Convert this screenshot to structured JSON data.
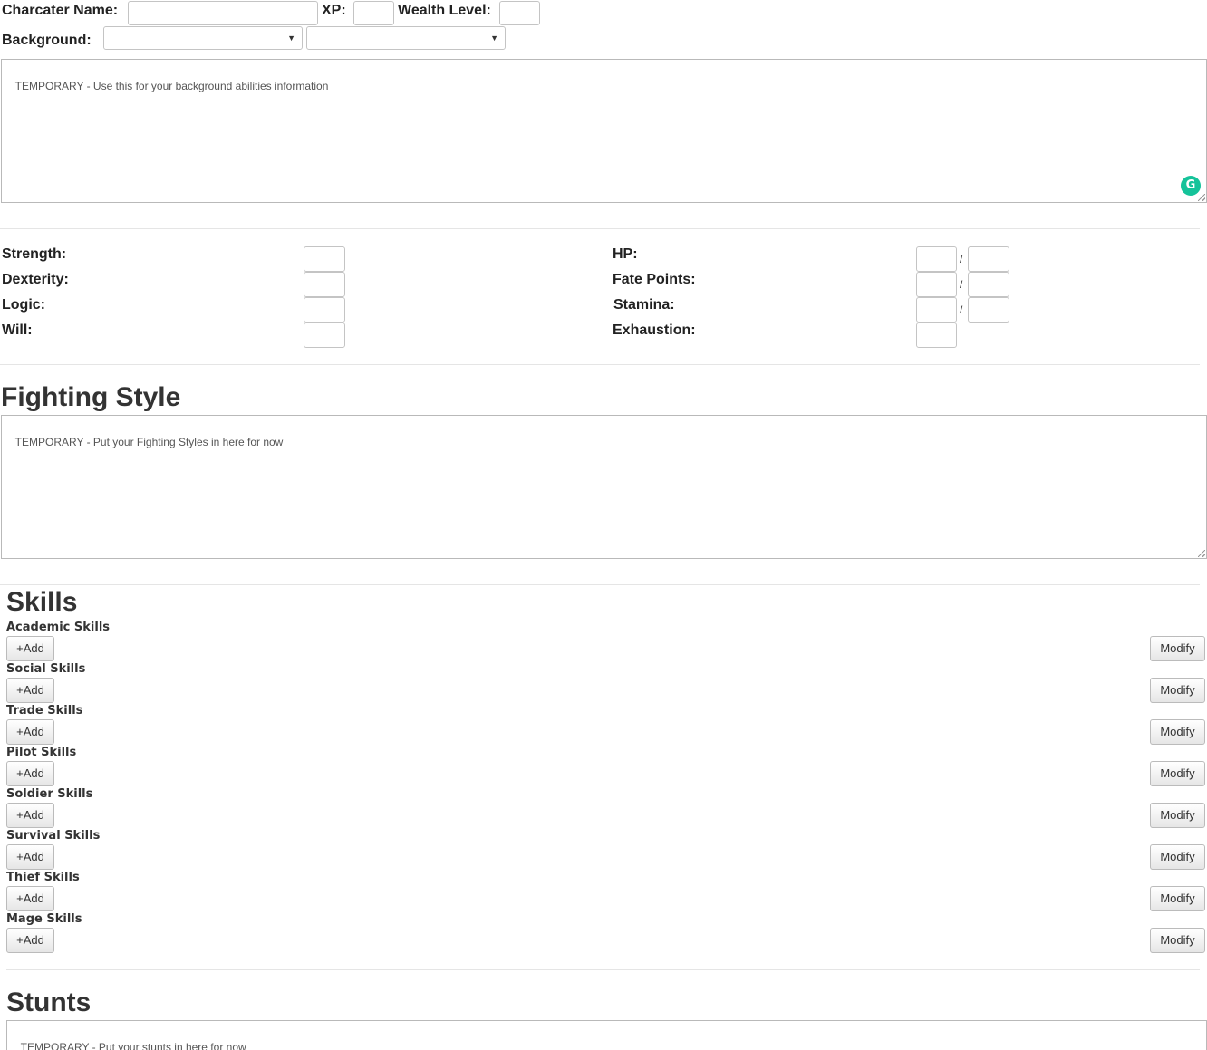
{
  "header": {
    "character_name_label": "Charcater Name:",
    "character_name_value": "",
    "xp_label": "XP:",
    "xp_value": "",
    "wealth_label": "Wealth Level:",
    "wealth_value": "",
    "background_label": "Background:",
    "background_select_1": "",
    "background_select_2": ""
  },
  "background_text": "TEMPORARY - Use this for your background abilities information",
  "grammarly_icon": "G",
  "attributes": {
    "strength_label": "Strength:",
    "dexterity_label": "Dexterity:",
    "logic_label": "Logic:",
    "will_label": "Will:"
  },
  "resources": {
    "hp_label": "HP:",
    "fate_points_label": "Fate Points:",
    "stamina_label": "Stamina:",
    "exhaustion_label": "Exhaustion:",
    "separator": "/"
  },
  "fighting_style": {
    "title": "Fighting Style",
    "text": "TEMPORARY - Put your Fighting Styles in here for now"
  },
  "skills": {
    "title": "Skills",
    "add_label": "+Add",
    "modify_label": "Modify",
    "categories": [
      "Academic Skills",
      "Social Skills",
      "Trade Skills",
      "Pilot Skills",
      "Soldier Skills",
      "Survival Skills",
      "Thief Skills",
      "Mage Skills"
    ]
  },
  "stunts": {
    "title": "Stunts",
    "text": "TEMPORARY - Put your stunts in here for now"
  }
}
